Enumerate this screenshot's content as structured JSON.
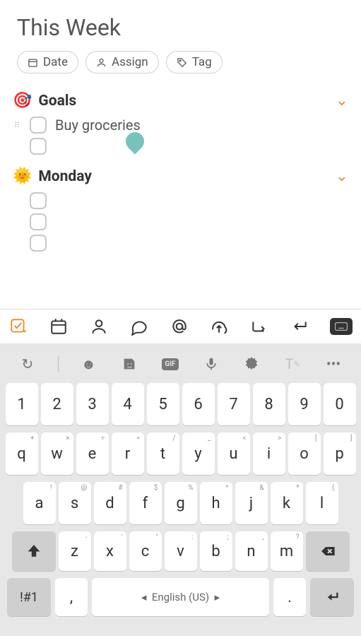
{
  "title": "This Week",
  "chips": {
    "date": "Date",
    "assign": "Assign",
    "tag": "Tag"
  },
  "sections": [
    {
      "emoji": "🎯",
      "title": "Goals",
      "tasks": [
        {
          "text": "Buy groceries"
        },
        {
          "text": ""
        }
      ]
    },
    {
      "emoji": "🌞",
      "title": "Monday",
      "tasks": [
        {
          "text": ""
        },
        {
          "text": ""
        },
        {
          "text": ""
        }
      ]
    }
  ],
  "keyboard": {
    "gif": "GIF",
    "numbers": [
      "1",
      "2",
      "3",
      "4",
      "5",
      "6",
      "7",
      "8",
      "9",
      "0"
    ],
    "row1": [
      {
        "k": "q",
        "s": "+"
      },
      {
        "k": "w",
        "s": "×"
      },
      {
        "k": "e",
        "s": "÷"
      },
      {
        "k": "r",
        "s": "="
      },
      {
        "k": "t",
        "s": "/"
      },
      {
        "k": "y",
        "s": "_"
      },
      {
        "k": "u",
        "s": "<"
      },
      {
        "k": "i",
        "s": ">"
      },
      {
        "k": "o",
        "s": "["
      },
      {
        "k": "p",
        "s": "]"
      }
    ],
    "row2": [
      {
        "k": "a",
        "s": "!"
      },
      {
        "k": "s",
        "s": "@"
      },
      {
        "k": "d",
        "s": "#"
      },
      {
        "k": "f",
        "s": "$"
      },
      {
        "k": "g",
        "s": "%"
      },
      {
        "k": "h",
        "s": "^"
      },
      {
        "k": "j",
        "s": "&"
      },
      {
        "k": "k",
        "s": "*"
      },
      {
        "k": "l",
        "s": "("
      }
    ],
    "row3": [
      {
        "k": "z",
        "s": "-"
      },
      {
        "k": "x",
        "s": "'"
      },
      {
        "k": "c",
        "s": "\""
      },
      {
        "k": "v",
        "s": ":"
      },
      {
        "k": "b",
        "s": ";"
      },
      {
        "k": "n",
        "s": ","
      },
      {
        "k": "m",
        "s": "?"
      }
    ],
    "sym": "!#1",
    "comma": ",",
    "space": "English (US)",
    "period": "."
  }
}
